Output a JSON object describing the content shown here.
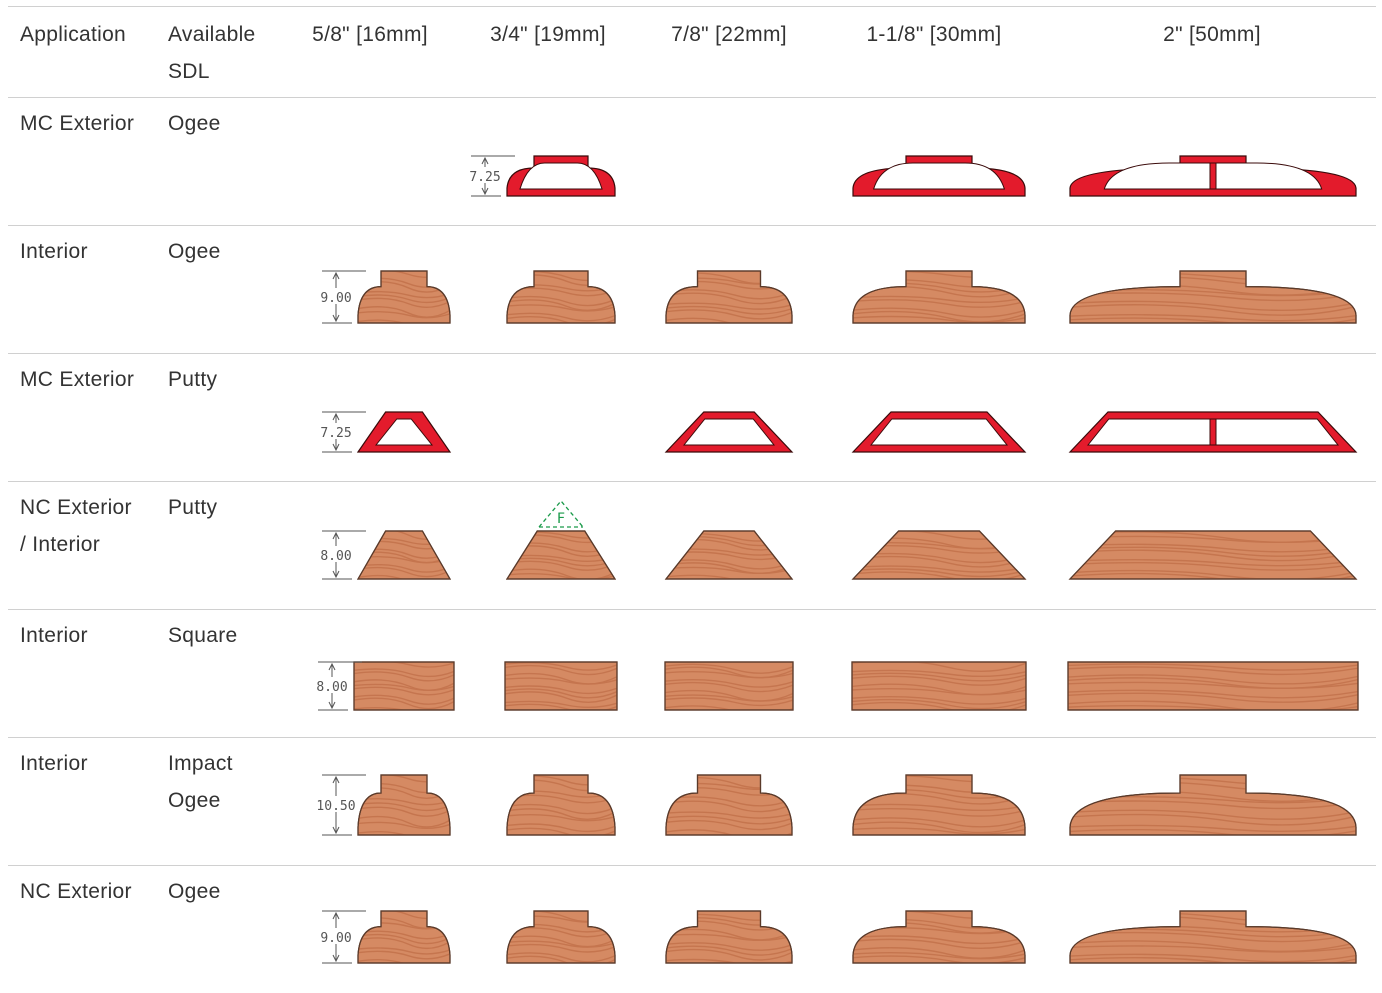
{
  "table": {
    "headers": [
      "Application",
      "Available\nSDL",
      "5/8\" [16mm]",
      "3/4\" [19mm]",
      "7/8\" [22mm]",
      "1-1/8\" [30mm]",
      "2\" [50mm]"
    ],
    "rows": [
      {
        "application": "MC Exterior",
        "sdl": "Ogee",
        "material": "aluminum",
        "dimension": "7.25",
        "dim_column": "3/4\" [19mm]",
        "profiles": [
          "",
          "ogee",
          "",
          "ogee",
          "ogee-double"
        ]
      },
      {
        "application": "Interior",
        "sdl": "Ogee",
        "material": "wood",
        "dimension": "9.00",
        "dim_column": "5/8\" [16mm]",
        "profiles": [
          "ogee",
          "ogee",
          "ogee",
          "ogee",
          "ogee"
        ]
      },
      {
        "application": "MC Exterior",
        "sdl": "Putty",
        "material": "aluminum",
        "dimension": "7.25",
        "dim_column": "5/8\" [16mm]",
        "profiles": [
          "putty",
          "",
          "putty",
          "putty",
          "putty-double"
        ]
      },
      {
        "application": "NC Exterior\n/ Interior",
        "sdl": "Putty",
        "material": "wood",
        "dimension": "8.00",
        "dim_column": "5/8\" [16mm]",
        "profiles": [
          "putty",
          "putty-peak",
          "putty",
          "putty",
          "putty"
        ],
        "marker": "F"
      },
      {
        "application": "Interior",
        "sdl": "Square",
        "material": "wood",
        "dimension": "8.00",
        "dim_column": "5/8\" [16mm]",
        "profiles": [
          "square",
          "square",
          "square",
          "square",
          "square"
        ]
      },
      {
        "application": "Interior",
        "sdl": "Impact\nOgee",
        "material": "wood",
        "dimension": "10.50",
        "dim_column": "5/8\" [16mm]",
        "profiles": [
          "ogee",
          "ogee",
          "ogee",
          "ogee",
          "ogee"
        ]
      },
      {
        "application": "NC Exterior",
        "sdl": "Ogee",
        "material": "wood",
        "dimension": "9.00",
        "dim_column": "5/8\" [16mm]",
        "profiles": [
          "ogee",
          "ogee",
          "ogee",
          "ogee",
          "ogee"
        ]
      }
    ]
  },
  "colors": {
    "aluminum": "#e31b2c",
    "wood": "#d58a63",
    "wood_grain": "#b8653f",
    "marker": "#1a9a4a",
    "rule": "#d0d0d0"
  }
}
